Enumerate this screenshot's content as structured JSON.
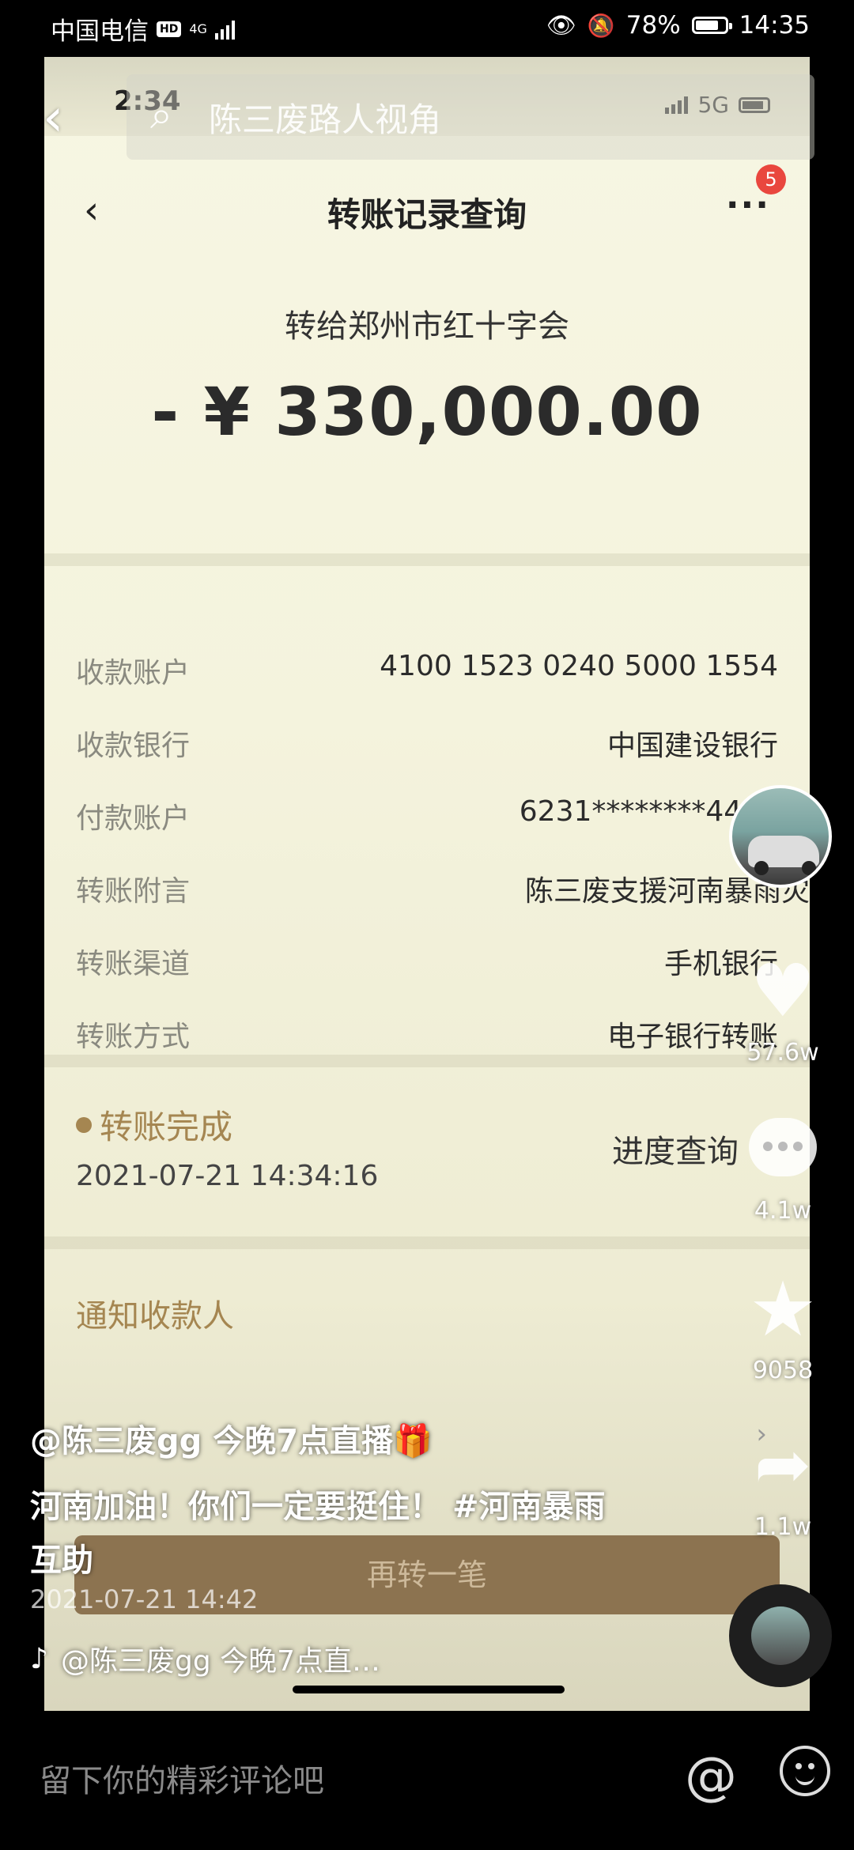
{
  "status_bar": {
    "carrier": "中国电信",
    "hd": "HD",
    "network": "4G",
    "battery": "78%",
    "time": "14:35"
  },
  "search": {
    "query": "陈三废路人视角"
  },
  "bank_screen": {
    "inner_time": "2:34",
    "inner_network": "5G",
    "title": "转账记录查询",
    "more": "···",
    "badge": "5",
    "recipient": "转给郑州市红十字会",
    "amount": "- ¥ 330,000.00",
    "details": [
      {
        "label": "收款账户",
        "value": "4100 1523 0240 5000 1554"
      },
      {
        "label": "收款银行",
        "value": "中国建设银行"
      },
      {
        "label": "付款账户",
        "value": "6231********4444"
      },
      {
        "label": "转账附言",
        "value": "陈三废支援河南暴雨灾"
      },
      {
        "label": "转账渠道",
        "value": "手机银行"
      },
      {
        "label": "转账方式",
        "value": "电子银行转账"
      }
    ],
    "status": "转账完成",
    "timestamp": "2021-07-21 14:34:16",
    "progress_link": "进度查询",
    "notify": "通知收款人",
    "again_button": "再转一笔"
  },
  "rail": {
    "likes": "57.6w",
    "comments": "4.1w",
    "favorites": "9058",
    "shares": "1.1w"
  },
  "post": {
    "author": "@陈三废gg 今晚7点直播🎁",
    "caption_text": "河南加油！你们一定要挺住！",
    "hashtag": "#河南暴雨互助",
    "time": "2021-07-21 14:42",
    "music": "@陈三废gg 今晚7点直…"
  },
  "comment_bar": {
    "placeholder": "留下你的精彩评论吧"
  }
}
